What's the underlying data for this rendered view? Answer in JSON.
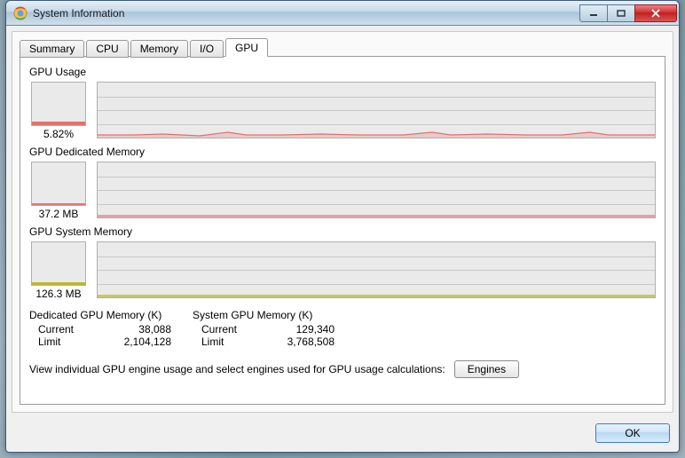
{
  "window": {
    "title": "System Information"
  },
  "tabs": [
    "Summary",
    "CPU",
    "Memory",
    "I/O",
    "GPU"
  ],
  "active_tab": "GPU",
  "gpu_usage": {
    "label": "GPU Usage",
    "value_text": "5.82%",
    "color": "#e57070"
  },
  "gpu_dedicated": {
    "label": "GPU Dedicated Memory",
    "value_text": "37.2 MB",
    "color": "#e57070"
  },
  "gpu_system": {
    "label": "GPU System Memory",
    "value_text": "126.3 MB",
    "color": "#b8b830"
  },
  "dedicated_stats": {
    "title": "Dedicated GPU Memory (K)",
    "current_label": "Current",
    "current_value": "38,088",
    "limit_label": "Limit",
    "limit_value": "2,104,128"
  },
  "system_stats": {
    "title": "System GPU Memory (K)",
    "current_label": "Current",
    "current_value": "129,340",
    "limit_label": "Limit",
    "limit_value": "3,768,508"
  },
  "engine_text": "View individual GPU engine usage and select engines used for GPU usage calculations:",
  "engines_button": "Engines",
  "ok_button": "OK",
  "chart_data": [
    {
      "type": "line",
      "title": "GPU Usage history",
      "ylim": [
        0,
        100
      ],
      "ylabel": "%",
      "values": [
        4,
        4,
        5,
        4,
        5,
        8,
        6,
        5,
        4,
        4,
        5,
        4,
        4,
        5,
        4,
        4,
        5,
        7,
        6,
        5,
        4,
        5,
        4,
        5,
        7,
        6,
        5,
        4,
        4
      ]
    },
    {
      "type": "line",
      "title": "GPU Dedicated Memory history",
      "ylabel": "MB",
      "values": [
        37,
        37,
        37,
        37,
        37,
        37,
        37,
        37,
        37,
        37,
        37,
        37,
        37,
        37,
        37,
        37,
        37,
        37,
        37,
        37
      ]
    },
    {
      "type": "line",
      "title": "GPU System Memory history",
      "ylabel": "MB",
      "values": [
        126,
        126,
        126,
        126,
        126,
        126,
        126,
        126,
        126,
        126,
        126,
        126,
        126,
        126,
        126,
        126,
        126,
        126,
        126,
        126
      ]
    }
  ]
}
